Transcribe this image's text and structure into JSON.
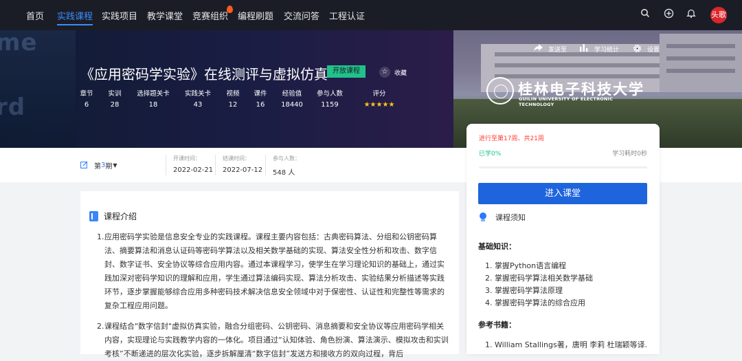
{
  "nav": {
    "items": [
      "首页",
      "实践课程",
      "实践项目",
      "教学课堂",
      "竞赛组织",
      "编程刷题",
      "交流问答",
      "工程认证"
    ],
    "active_index": 1,
    "avatar_text": "头歌",
    "icons": [
      "search-icon",
      "plus-circle-icon",
      "bell-icon"
    ]
  },
  "banner": {
    "deco_text": [
      "me",
      "rd"
    ],
    "title": "《应用密码学实验》在线测评与虚拟仿真",
    "badge": "开放课程",
    "favorite": "收藏",
    "actions": [
      "发送至",
      "学习统计",
      "设置"
    ],
    "stats": [
      {
        "label": "章节",
        "value": "6"
      },
      {
        "label": "实训",
        "value": "28"
      },
      {
        "label": "选择题关卡",
        "value": "18"
      },
      {
        "label": "实践关卡",
        "value": "43"
      },
      {
        "label": "视频",
        "value": "12"
      },
      {
        "label": "课件",
        "value": "16"
      },
      {
        "label": "经验值",
        "value": "18440"
      },
      {
        "label": "参与人数",
        "value": "1159"
      }
    ],
    "rating_label": "评分",
    "rating_stars": 5,
    "logo_cn": "桂林电子科技大学",
    "logo_en": "GUILIN UNIVERSITY OF ELECTRONIC TECHNOLOGY"
  },
  "info": {
    "term_prefix": "第",
    "term_num": "3",
    "term_suffix": "期",
    "start_label": "开课时间：",
    "start_value": "2022-02-21",
    "end_label": "结课时间：",
    "end_value": "2022-07-12",
    "people_label": "参与人数：",
    "people_value": "548 人"
  },
  "intro": {
    "title": "课程介绍",
    "p1_no": "1.",
    "p1": "应用密码学实验是信息安全专业的实践课程。课程主要内容包括：古典密码算法、分组和公钥密码算法、摘要算法和消息认证码等密码学算法以及相关数学基础的实现、算法安全性分析和攻击、数字信封、数字证书、安全协议等综合应用内容。通过本课程学习，使学生在学习理论知识的基础上，通过实践加深对密码学知识的理解和应用，学生通过算法编码实现、算法分析攻击、实验结果分析描述等实践环节，逐步掌握能够综合应用多种密码技术解决信息安全领域中对于保密性、认证性和完整性等需求的复杂工程应用问题。",
    "p2_no": "2.",
    "p2": "课程结合\"数字信封\"虚拟仿真实验，融合分组密码、公钥密码、消息摘要和安全协议等应用密码学相关内容，实现理论与实践教学内容的一体化。项目通过“认知体验、角色扮演、算法演示、模拟攻击和实训考核”不断递进的层次化实验，逐步拆解厘清“数字信封”发送方和接收方的双向过程，背后"
  },
  "side": {
    "progress": "进行至第17周、共21周",
    "percent_label": "已学0%",
    "percent_value": 0,
    "used": "学习耗时0秒",
    "enter_button": "进入课堂",
    "notice": "课程须知",
    "basic_title": "基础知识：",
    "basic_items": [
      "1. 掌握Python语言编程",
      "2. 掌握密码学算法相关数学基础",
      "3. 掌握密码学算法原理",
      "4. 掌握密码学算法的综合应用"
    ],
    "ref_title": "参考书籍：",
    "ref_first": "1. William Stallings著，唐明 李莉 杜瑞颖等译."
  }
}
